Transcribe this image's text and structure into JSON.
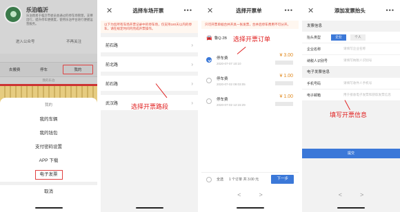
{
  "panel1": {
    "account_name": "乐泊临沂",
    "description": "乐泊周易于临沂市委员会通过的停车场管理，支撑出行，提升停车便捷度，使用乐泊平台进行便捷运营服务。",
    "links": [
      "进入公众号",
      "不再关注"
    ],
    "menu": [
      "去搬费",
      "停车",
      "我的"
    ],
    "sub_text": "我的乐泊",
    "sheet_title": "我的",
    "sheet_items": [
      "我的车辆",
      "我的钱包",
      "支付密码设置",
      "APP 下载",
      "电子发票"
    ],
    "cancel_label": "取消"
  },
  "panel2": {
    "title": "选择车场开票",
    "notice": "以下为您所有车场开票记录中的停车场，仅支持180天以内的停车，请在规定时间内完成开票操作。",
    "routes": [
      "前石路",
      "前北路",
      "前石路",
      "武汉路"
    ]
  },
  "panel3": {
    "title": "选择开票单",
    "notice": "只可开票单据合并开具一张发票，合并后停车费用不可分开。",
    "car_label": "鲁Q·2B",
    "orders": [
      {
        "name": "停车费",
        "time": "2020-07-07 10:10",
        "amount": "¥ 3.00",
        "selected": true
      },
      {
        "name": "停车费",
        "time": "2020-07-02 09:03:05",
        "amount": "¥ 1.00",
        "selected": false
      },
      {
        "name": "停车费",
        "time": "2020-07-02 12:15:29",
        "amount": "¥ 1.00",
        "selected": false
      }
    ],
    "select_all": "全选",
    "summary": "1 个订单 共 3.00 元",
    "next_label": "下一步",
    "nav_back": "<",
    "nav_forward": ">"
  },
  "panel4": {
    "title": "添加发票抬头",
    "section_title": "发票信息",
    "type_label": "抬头类型",
    "type_options": [
      "企业",
      "个人"
    ],
    "fields": [
      {
        "label": "企业名称",
        "placeholder": "请填写企业名称"
      },
      {
        "label": "纳税人识别号",
        "placeholder": "请填写纳税人识别号"
      }
    ],
    "email_section": "电子发票信息",
    "contact_fields": [
      {
        "label": "手机号码",
        "placeholder": "请填写收件人手机号"
      },
      {
        "label": "电子邮箱",
        "placeholder": "用于接收电子发票和获取发票信息"
      }
    ],
    "submit_label": "提交",
    "nav_back": "<",
    "nav_forward": ">"
  },
  "annotations": {
    "route": "选择开票路段",
    "order": "选择开票订单",
    "info": "填写开票信息"
  },
  "colors": {
    "accent": "#3b78d8",
    "annotation": "#e02020",
    "amount": "#e08a20"
  }
}
